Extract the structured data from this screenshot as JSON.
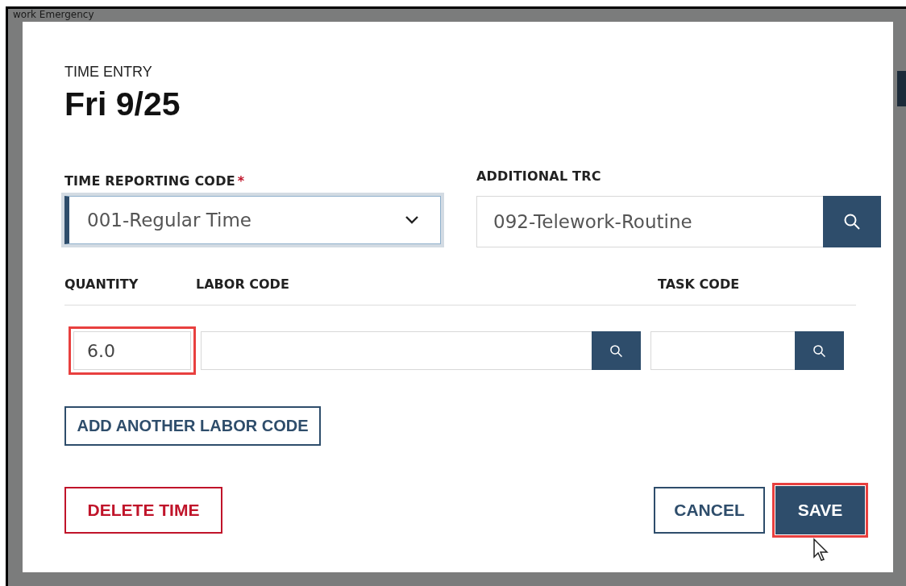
{
  "background": {
    "heading": "work Emergency"
  },
  "dialog": {
    "eyebrow": "TIME ENTRY",
    "title": "Fri 9/25"
  },
  "time_reporting_code": {
    "label": "TIME REPORTING CODE",
    "required_mark": "*",
    "value": "001-Regular Time"
  },
  "additional_trc": {
    "label": "ADDITIONAL TRC",
    "value": "092-Telework-Routine"
  },
  "labor_columns": [
    "QUANTITY",
    "LABOR CODE",
    "TASK CODE"
  ],
  "labor_row": {
    "quantity": "6.0",
    "quantity_highlighted": true
  },
  "add_button": "ADD ANOTHER LABOR CODE",
  "buttons": [
    {
      "kind": "danger",
      "label": "DELETE TIME",
      "highlighted": false
    },
    {
      "kind": "secondary",
      "label": "CANCEL",
      "highlighted": false
    },
    {
      "kind": "primary",
      "label": "SAVE",
      "highlighted": true
    }
  ]
}
